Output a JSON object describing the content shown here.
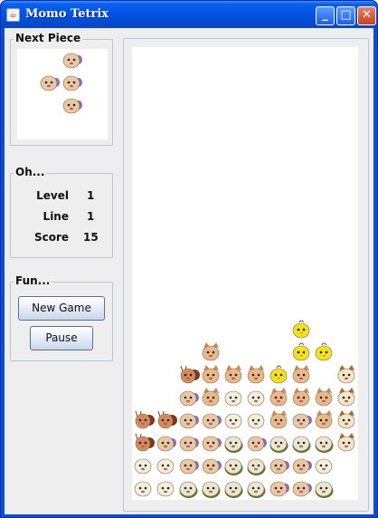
{
  "window": {
    "title": "Momo Tetrix",
    "icon": "java-cup-icon",
    "controls": [
      "minimize-icon",
      "maximize-icon",
      "close-icon"
    ]
  },
  "next_piece": {
    "title": "Next Piece",
    "creature": "pink-pig",
    "cells": [
      [
        1,
        0
      ],
      [
        0,
        1
      ],
      [
        1,
        1
      ],
      [
        1,
        2
      ]
    ]
  },
  "stats": {
    "title": "Oh...",
    "level_label": "Level",
    "level_value": "1",
    "line_label": "Line",
    "line_value": "1",
    "score_label": "Score",
    "score_value": "15"
  },
  "fun": {
    "title": "Fun...",
    "new_game_label": "New Game",
    "pause_label": "Pause"
  },
  "board": {
    "columns": 10,
    "rows": 20,
    "creatures": {
      "P": {
        "name": "pink-pig",
        "face": "#e9c8a4",
        "ear": "#8a6cc8"
      },
      "C": {
        "name": "tan-cat",
        "face": "#e9b98a",
        "ear": "#c88a5a"
      },
      "Y": {
        "name": "yellow-chick",
        "face": "#f2e21c",
        "ear": "#c7b800"
      },
      "H": {
        "name": "hamster",
        "face": "#f4e6c8",
        "ear": "#a86a2a"
      },
      "S": {
        "name": "snail",
        "face": "#d48a5a",
        "ear": "#7a3a1a"
      },
      "W": {
        "name": "white-sheep",
        "face": "#f0f0dc",
        "ear": "#c8c8a8"
      },
      "G": {
        "name": "green-frog",
        "face": "#e8e8d0",
        "ear": "#5a7a2a"
      }
    },
    "grid": [
      "..........",
      "..........",
      "..........",
      "..........",
      "..........",
      "..........",
      "..........",
      "..........",
      "..........",
      "..........",
      "..........",
      "..........",
      "..........",
      "...... Y..",
      "...C. .YY.H",
      "..SCCCYC.H",
      "..PCWWCCCH",
      "SSPPWWCPCH",
      "SPPPGPGGGH",
      "WWPPGGPPW.",
      "WWGGGGPPG."
    ]
  }
}
